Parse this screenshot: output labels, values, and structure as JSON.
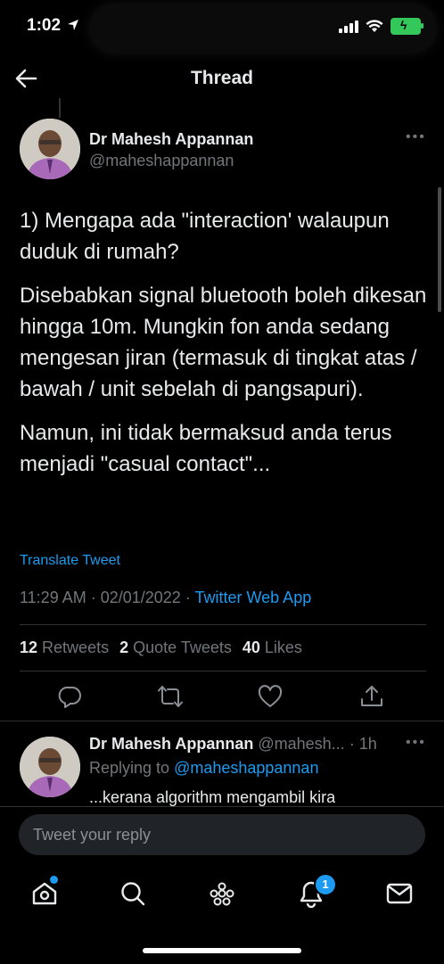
{
  "status_bar": {
    "time": "1:02"
  },
  "header": {
    "title": "Thread"
  },
  "tweet": {
    "author_name": "Dr Mahesh Appannan",
    "author_handle": "@maheshappannan",
    "paragraphs": [
      "1) Mengapa ada \"interaction' walaupun duduk di rumah?",
      "Disebabkan signal bluetooth boleh dikesan hingga 10m. Mungkin fon anda sedang mengesan jiran (termasuk di tingkat atas / bawah / unit sebelah di pangsapuri).",
      "Namun, ini tidak bermaksud anda terus menjadi \"casual contact\"..."
    ],
    "translate_label": "Translate Tweet",
    "timestamp": "11:29 AM · 02/01/2022 · ",
    "source": "Twitter Web App",
    "stats": {
      "retweets_count": "12",
      "retweets_label": "Retweets",
      "quotes_count": "2",
      "quotes_label": "Quote Tweets",
      "likes_count": "40",
      "likes_label": "Likes"
    },
    "actions": [
      "reply-icon",
      "retweet-icon",
      "like-icon",
      "share-icon"
    ]
  },
  "reply": {
    "author_name": "Dr Mahesh Appannan",
    "author_handle": "@mahesh...",
    "time": "· 1h",
    "replying_prefix": "Replying to ",
    "replying_to": "@maheshappannan",
    "text": "...kerana algorithm mengambil kira"
  },
  "composer": {
    "placeholder": "Tweet your reply"
  },
  "bottom_nav": {
    "items": [
      "home-icon",
      "search-icon",
      "spaces-icon",
      "notifications-icon",
      "messages-icon"
    ],
    "notifications_badge": "1"
  },
  "colors": {
    "accent": "#1d9bf0",
    "background": "#000000",
    "secondary_text": "#71767b"
  }
}
